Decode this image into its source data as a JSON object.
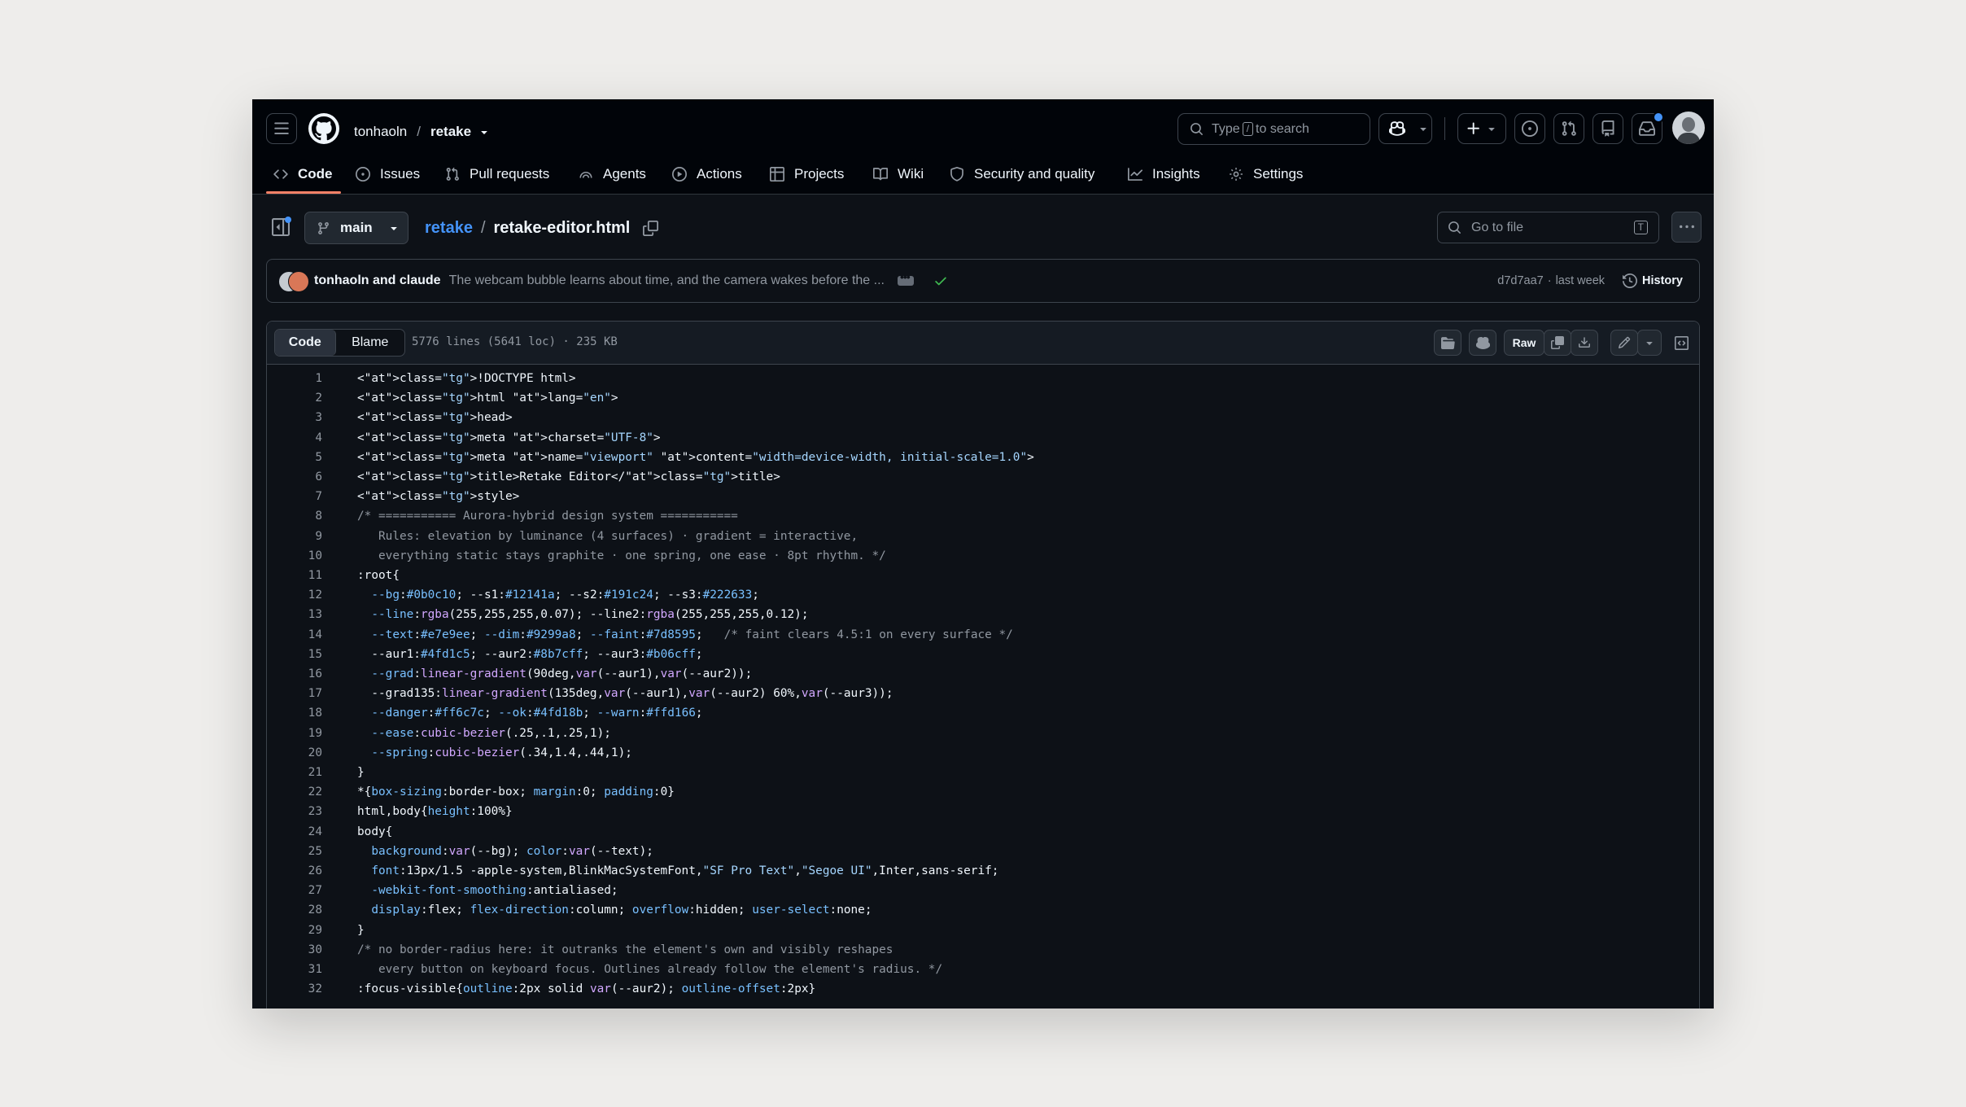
{
  "header": {
    "owner": "tonhaoln",
    "separator": "/",
    "repo": "retake",
    "search_prefix": "Type",
    "search_key": "/",
    "search_suffix": "to search"
  },
  "tabs": [
    {
      "label": "Code",
      "icon": "code-icon"
    },
    {
      "label": "Issues",
      "icon": "issue-opened-icon"
    },
    {
      "label": "Pull requests",
      "icon": "git-pull-request-icon"
    },
    {
      "label": "Agents",
      "icon": "agent-icon"
    },
    {
      "label": "Actions",
      "icon": "play-icon"
    },
    {
      "label": "Projects",
      "icon": "table-icon"
    },
    {
      "label": "Wiki",
      "icon": "book-icon"
    },
    {
      "label": "Security and quality",
      "icon": "shield-icon"
    },
    {
      "label": "Insights",
      "icon": "graph-icon"
    },
    {
      "label": "Settings",
      "icon": "gear-icon"
    }
  ],
  "file_nav": {
    "branch": "main",
    "repo_link": "retake",
    "separator": "/",
    "filename": "retake-editor.html",
    "goto_placeholder": "Go to file",
    "goto_key": "T"
  },
  "commit": {
    "authors": "tonhaoln and claude",
    "message": "The webcam bubble learns about time, and the camera wakes before the ...",
    "hash": "d7d7aa7",
    "time_sep": "·",
    "time": "last week",
    "history_label": "History"
  },
  "file_header": {
    "code_tab": "Code",
    "blame_tab": "Blame",
    "meta": "5776 lines (5641 loc) · 235 KB",
    "raw_label": "Raw"
  },
  "colors": {
    "accent_link": "#4493f8",
    "tab_underline": "#f78166",
    "success": "#3fb950"
  },
  "code_lines": [
    "<!DOCTYPE html>",
    "<html lang=\"en\">",
    "<head>",
    "<meta charset=\"UTF-8\">",
    "<meta name=\"viewport\" content=\"width=device-width, initial-scale=1.0\">",
    "<title>Retake Editor</title>",
    "<style>",
    "/* =========== Aurora-hybrid design system ===========",
    "   Rules: elevation by luminance (4 surfaces) · gradient = interactive,",
    "   everything static stays graphite · one spring, one ease · 8pt rhythm. */",
    ":root{",
    "  --bg:#0b0c10; --s1:#12141a; --s2:#191c24; --s3:#222633;",
    "  --line:rgba(255,255,255,0.07); --line2:rgba(255,255,255,0.12);",
    "  --text:#e7e9ee; --dim:#9299a8; --faint:#7d8595;   /* faint clears 4.5:1 on every surface */",
    "  --aur1:#4fd1c5; --aur2:#8b7cff; --aur3:#b06cff;",
    "  --grad:linear-gradient(90deg,var(--aur1),var(--aur2));",
    "  --grad135:linear-gradient(135deg,var(--aur1),var(--aur2) 60%,var(--aur3));",
    "  --danger:#ff6c7c; --ok:#4fd18b; --warn:#ffd166;",
    "  --ease:cubic-bezier(.25,.1,.25,1);",
    "  --spring:cubic-bezier(.34,1.4,.44,1);",
    "}",
    "*{box-sizing:border-box; margin:0; padding:0}",
    "html,body{height:100%}",
    "body{",
    "  background:var(--bg); color:var(--text);",
    "  font:13px/1.5 -apple-system,BlinkMacSystemFont,\"SF Pro Text\",\"Segoe UI\",Inter,sans-serif;",
    "  -webkit-font-smoothing:antialiased;",
    "  display:flex; flex-direction:column; overflow:hidden; user-select:none;",
    "}",
    "/* no border-radius here: it outranks the element's own and visibly reshapes",
    "   every button on keyboard focus. Outlines already follow the element's radius. */",
    ":focus-visible{outline:2px solid var(--aur2); outline-offset:2px}"
  ]
}
